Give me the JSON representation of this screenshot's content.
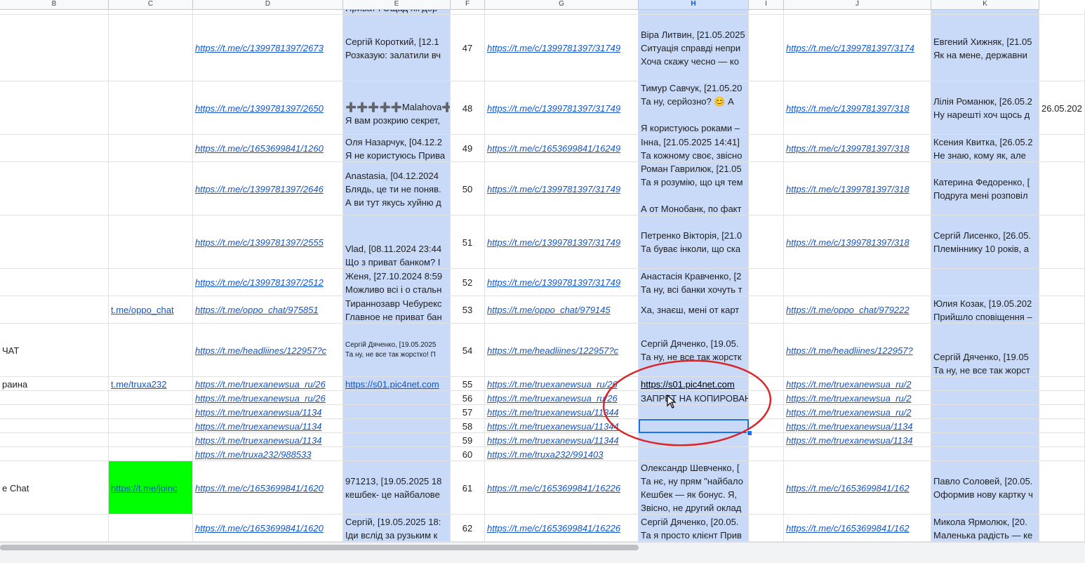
{
  "columns": {
    "B": "B",
    "C": "C",
    "D": "D",
    "E": "E",
    "F": "F",
    "G": "G",
    "H": "H",
    "I": "I",
    "J": "J",
    "K": "K"
  },
  "rows": [
    {
      "e": [
        "Приват і Ощад як дер"
      ],
      "f": "",
      "h": [],
      "k": []
    },
    {
      "d": "https://t.me/c/1399781397/2673",
      "e": [
        "Сергій Короткий, [12.1",
        "Розказую: залатили вч"
      ],
      "f": "47",
      "g": "https://t.me/c/1399781397/31749",
      "h": [
        "Віра Литвин, [21.05.2025",
        "Ситуація справді непри",
        "Хоча скажу чесно — ко"
      ],
      "j": "https://t.me/c/1399781397/3174",
      "k": [
        "Евгений Хижняк, [21.05",
        "Як на мене, державни"
      ]
    },
    {
      "d": "https://t.me/c/1399781397/2650",
      "e": [
        "➕➕➕➕➕Malahova➕",
        "Я вам розкрию секрет,"
      ],
      "f": "48",
      "g": "https://t.me/c/1399781397/31749",
      "h": [
        "Тимур Савчук, [21.05.20",
        "Та ну, серйозно? 😊 А",
        "",
        "Я користуюсь роками –"
      ],
      "j": "https://t.me/c/1399781397/318",
      "k": [
        "Лілія Романюк, [26.05.2",
        "Ну нарешті хоч щось д"
      ],
      "l": "26.05.202"
    },
    {
      "d": "https://t.me/c/1653699841/1260",
      "e": [
        "Оля Назарчук, [04.12.2",
        "Я не користуюсь Прива"
      ],
      "f": "49",
      "g": "https://t.me/c/1653699841/16249",
      "h": [
        "Інна, [21.05.2025 14:41]",
        "Та кожному своє, звісно"
      ],
      "j": "https://t.me/c/1399781397/318",
      "k": [
        "Ксения Квитка, [26.05.2",
        "Не знаю, кому як, але"
      ]
    },
    {
      "d": "https://t.me/c/1399781397/2646",
      "e": [
        "Anastasia, [04.12.2024",
        "Блядь, це ти не поняв.",
        "А ви тут якусь хуйню д"
      ],
      "f": "50",
      "g": "https://t.me/c/1399781397/31749",
      "h": [
        "Роман Гаврилюк, [21.05",
        "Та я розумію, що ця тем",
        "",
        "А от Монобанк, по факт"
      ],
      "j": "https://t.me/c/1399781397/318",
      "k": [
        "Катерина Федоренко, [",
        "Подруга мені розповіл"
      ]
    },
    {
      "d": "https://t.me/c/1399781397/2555",
      "e": [
        "Vlad, [08.11.2024 23:44",
        "Що з приват банком? І"
      ],
      "f": "51",
      "g": "https://t.me/c/1399781397/31749",
      "h": [
        "Петренко Вікторія, [21.0",
        "Та буває інколи, що ска"
      ],
      "j": "https://t.me/c/1399781397/318",
      "k": [
        "Сергій Лисенко, [26.05.",
        "Племіннику 10 років, а"
      ]
    },
    {
      "d": "https://t.me/c/1399781397/2512",
      "e": [
        "Женя, [27.10.2024 8:59",
        "Можливо всі і о стальн"
      ],
      "f": "52",
      "g": "https://t.me/c/1399781397/31749",
      "h": [
        "Анастасія Кравченко, [2",
        "Та ну, всі банки хочуть т"
      ],
      "j": "",
      "k": []
    },
    {
      "c": "t.me/oppo_chat",
      "d": "https://t.me/oppo_chat/975851",
      "e": [
        "Тираннозавр Чебурекс",
        "Главное не приват бан"
      ],
      "f": "53",
      "g": "https://t.me/oppo_chat/979145",
      "h": [
        "Ха, знаєш, мені от карт"
      ],
      "j": "https://t.me/oppo_chat/979222",
      "k": [
        "Юлия Козак, [19.05.202",
        "Прийшло сповіщення –"
      ]
    },
    {
      "b": "ЧАТ",
      "d": "https://t.me/headliines/122957?c",
      "e": [
        "Сергій Дяченко, [19.05.2025",
        "Та ну, не все так жорстко! П"
      ],
      "f": "54",
      "g": "https://t.me/headliines/122957?c",
      "h": [
        "Сергій Дяченко, [19.05.",
        "Та ну, не все так жорстк"
      ],
      "j": "https://t.me/headliines/122957?",
      "k": [
        "Сергій Дяченко, [19.05",
        "Та ну, не все так жорст"
      ]
    },
    {
      "b": "раина",
      "c": "t.me/truxa232",
      "d": "https://t.me/truexanewsua_ru/26",
      "e": [
        "https://s01.pic4net.com"
      ],
      "f": "55",
      "g": "https://t.me/truexanewsua_ru/26",
      "h": [
        "https://s01.pic4net.com"
      ],
      "j": "https://t.me/truexanewsua_ru/2",
      "k": []
    },
    {
      "d": "https://t.me/truexanewsua_ru/26",
      "f": "56",
      "g": "https://t.me/truexanewsua_ru/26",
      "h": [
        "ЗАПРЕТ НА КОПИРОВАН"
      ],
      "j": "https://t.me/truexanewsua_ru/2"
    },
    {
      "d": "https://t.me/truexanewsua/1134",
      "f": "57",
      "g": "https://t.me/truexanewsua/11344",
      "h": [],
      "j": "https://t.me/truexanewsua_ru/2"
    },
    {
      "d": "https://t.me/truexanewsua/1134",
      "f": "58",
      "g": "https://t.me/truexanewsua/11344",
      "h": [],
      "j": "https://t.me/truexanewsua/1134"
    },
    {
      "d": "https://t.me/truexanewsua/1134",
      "f": "59",
      "g": "https://t.me/truexanewsua/11344",
      "h": [],
      "j": "https://t.me/truexanewsua/1134"
    },
    {
      "d": "https://t.me/truxa232/988533",
      "f": "60",
      "g": "https://t.me/truxa232/991403",
      "h": [],
      "j": ""
    },
    {
      "b": "e Chat",
      "c": "https://t.me/joinc",
      "d": "https://t.me/c/1653699841/1620",
      "e": [
        "971213, [19.05.2025 18",
        "кешбек- це найбалове"
      ],
      "f": "61",
      "g": "https://t.me/c/1653699841/16226",
      "h": [
        "Олександр Шевченко, [",
        "Та нє, ну прям \"найбало",
        "Кешбек — як бонус. Я,",
        "Звісно, не другий оклад"
      ],
      "j": "https://t.me/c/1653699841/162",
      "k": [
        "Павло Соловей, [20.05.",
        "Оформив нову картку ч"
      ]
    },
    {
      "d": "https://t.me/c/1653699841/1620",
      "e": [
        "Сергій, [19.05.2025 18:",
        "Іди вслід за рузьким к"
      ],
      "f": "62",
      "g": "https://t.me/c/1653699841/16226",
      "h": [
        "Сергій Дяченко, [20.05.",
        "Та я просто клієнт Прив"
      ],
      "j": "https://t.me/c/1653699841/162",
      "k": [
        "Микола Ярмолюк, [20.",
        "Маленька радість — ке"
      ]
    }
  ]
}
